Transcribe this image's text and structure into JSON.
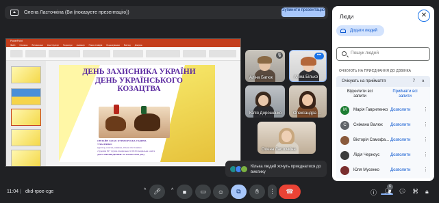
{
  "banner": {
    "text": "Олена Ласточкіна (Ви (показуєте презентацію))",
    "stop_label": "Зупинити презентацію"
  },
  "ppt": {
    "title": "PowerPoint",
    "menu": [
      "Файл",
      "Основне",
      "Вставлення",
      "Конструктор",
      "Переходи",
      "Анімація",
      "Показ слайдів",
      "Рецензування",
      "Вигляд",
      "Довідка"
    ]
  },
  "slide": {
    "title": "ДЕНЬ ЗАХИСНИКА УКРАЇНИ ДЕНЬ УКРАЇНСЬКОГО КОЗАЦТВА",
    "body_heading": "ОНЛАЙН ЗАХІД: КУРАТОРСЬКА ГОДИНА",
    "body_label": "УЧАСНИКИ:",
    "body_line1": "куратор, класна, книжка, Олена Ласточкіна",
    "body_line2": "студенти 817 групи спеціальності 016 Спеціальна освіта",
    "body_date": "ДАТА ПРОВЕДЕННЯ: 01 жовтня 2024 року"
  },
  "tiles": [
    {
      "name": "Аліна Батюк"
    },
    {
      "name": "Аліна Білько"
    },
    {
      "name": "Юлія Дорошенко"
    },
    {
      "name": "Олександра ..."
    },
    {
      "name": "Олена Ласточкіна"
    }
  ],
  "toast": {
    "text": "Кілька людей хочуть приєднатися до виклику"
  },
  "bottom": {
    "clock": "11:04",
    "separator": "|",
    "meeting_code": "dkd-rpoe-cge",
    "people_count": "6"
  },
  "panel": {
    "title": "Люди",
    "add_people": "Додати людей",
    "search_placeholder": "Пошук людей",
    "section": "ОЧІКУЮТЬ НА ПРИЄДНАННЯ ДО ДЗВІНКА",
    "waiting_label": "Очікують на приймаття",
    "waiting_count": "7",
    "reject_all": "Відхилити всі запити",
    "accept_all": "Прийняти всі запити",
    "allow_label": "Дозволити",
    "requests": [
      {
        "initial": "М",
        "name": "Марія Гавриленко",
        "color": "#1e7e34"
      },
      {
        "initial": "С",
        "name": "Сніжана Валюх",
        "color": "#5f6368"
      },
      {
        "initial": "",
        "name": "Вікторія Самофа...",
        "color": "#8a5a3c"
      },
      {
        "initial": "",
        "name": "Лідія Черноус",
        "color": "#3c3c3c"
      },
      {
        "initial": "",
        "name": "Юля Мусенко",
        "color": "#7a2e2e"
      }
    ]
  }
}
